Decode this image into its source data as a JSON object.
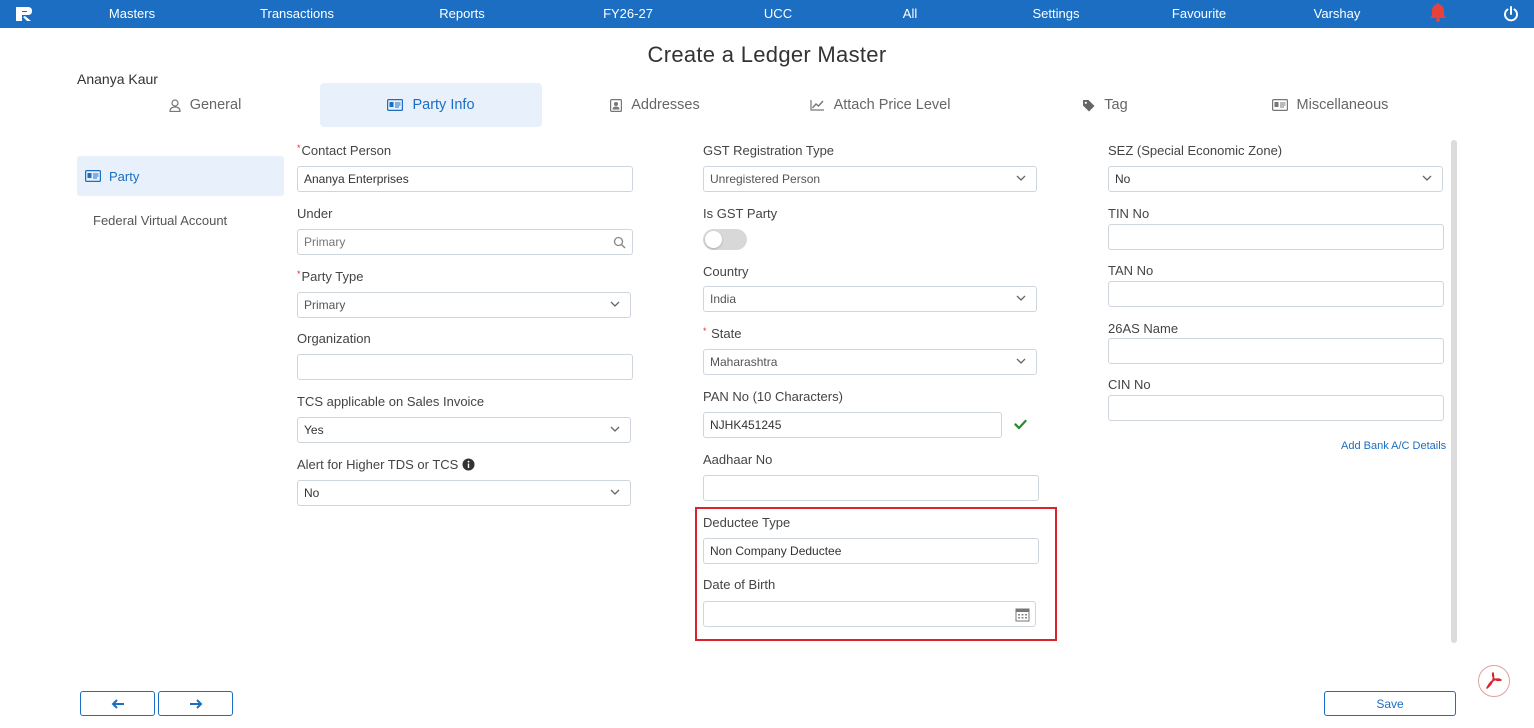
{
  "nav": {
    "items": [
      "Masters",
      "Transactions",
      "Reports",
      "FY26-27",
      "UCC",
      "All",
      "Settings",
      "Favourite",
      "Varshay"
    ]
  },
  "page": {
    "title": "Create a Ledger Master",
    "user_name": "Ananya Kaur"
  },
  "tabs": [
    {
      "label": "General",
      "icon": "user-icon"
    },
    {
      "label": "Party Info",
      "icon": "id-card-icon",
      "active": true
    },
    {
      "label": "Addresses",
      "icon": "contact-book-icon"
    },
    {
      "label": "Attach Price Level",
      "icon": "line-chart-icon"
    },
    {
      "label": "Tag",
      "icon": "tag-icon"
    },
    {
      "label": "Miscellaneous",
      "icon": "id-card-icon"
    }
  ],
  "sidebar": {
    "items": [
      {
        "label": "Party",
        "icon": "id-card-icon",
        "active": true
      },
      {
        "label": "Federal Virtual Account"
      }
    ]
  },
  "form": {
    "contact_person": {
      "label": "Contact Person",
      "value": "Ananya Enterprises",
      "required": true
    },
    "under": {
      "label": "Under",
      "placeholder": "Primary"
    },
    "party_type": {
      "label": "Party Type",
      "value": "Primary",
      "required": true
    },
    "organization": {
      "label": "Organization",
      "value": ""
    },
    "tcs_applicable": {
      "label": "TCS applicable on Sales Invoice",
      "value": "Yes"
    },
    "alert_higher_tds": {
      "label": "Alert for Higher TDS or TCS",
      "value": "No"
    },
    "gst_registration_type": {
      "label": "GST Registration Type",
      "value": "Unregistered Person"
    },
    "is_gst_party": {
      "label": "Is GST Party",
      "on": false
    },
    "country": {
      "label": "Country",
      "value": "India"
    },
    "state": {
      "label": "State",
      "value": "Maharashtra",
      "required": true
    },
    "pan_no": {
      "label": "PAN No (10 Characters)",
      "value": "NJHK451245",
      "verified": true
    },
    "aadhaar_no": {
      "label": "Aadhaar No",
      "value": ""
    },
    "deductee_type": {
      "label": "Deductee Type",
      "value": "Non Company Deductee"
    },
    "date_of_birth": {
      "label": "Date of Birth",
      "value": ""
    },
    "sez": {
      "label": "SEZ (Special Economic Zone)",
      "value": "No"
    },
    "tin_no": {
      "label": "TIN No",
      "value": ""
    },
    "tan_no": {
      "label": "TAN No",
      "value": ""
    },
    "as26_name": {
      "label": "26AS Name",
      "value": ""
    },
    "cin_no": {
      "label": "CIN No",
      "value": ""
    },
    "add_bank_link": "Add Bank A/C Details"
  },
  "footer": {
    "save_label": "Save"
  },
  "colors": {
    "primary": "#1b6ec2",
    "active_tab_bg": "#e8f1fb",
    "highlight_border": "#d9232d",
    "success": "#2e8b2e"
  }
}
